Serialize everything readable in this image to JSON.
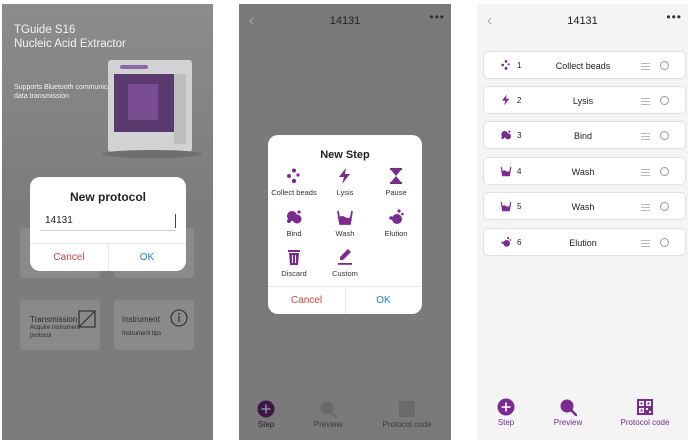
{
  "colors": {
    "accent": "#7b2b8f",
    "cancel": "#d1413e",
    "ok": "#1f7bd8"
  },
  "screen1": {
    "hero_title_line1": "TGuide S16",
    "hero_title_line2": "Nucleic Acid Extractor",
    "hero_support": "Supports Bluetooth communication, the data transmission",
    "cards": [
      {
        "label": "Transmission",
        "sub": "Acquire instrument protocol",
        "icon": "transmission-icon"
      },
      {
        "label": "Instrument",
        "sub": "Instrument tips",
        "icon": "info-icon"
      }
    ],
    "dialog": {
      "title": "New protocol",
      "input_value": "14131",
      "cancel_label": "Cancel",
      "ok_label": "OK"
    }
  },
  "screen2": {
    "header": {
      "title": "14131",
      "more": "•••"
    },
    "dialog": {
      "title": "New Step",
      "steps": [
        {
          "label": "Collect beads",
          "icon": "collect-beads-icon"
        },
        {
          "label": "Lysis",
          "icon": "lysis-icon"
        },
        {
          "label": "Pause",
          "icon": "pause-icon"
        },
        {
          "label": "Bind",
          "icon": "bind-icon"
        },
        {
          "label": "Wash",
          "icon": "wash-icon"
        },
        {
          "label": "Elution",
          "icon": "elution-icon"
        },
        {
          "label": "Discard",
          "icon": "discard-icon"
        },
        {
          "label": "Custom",
          "icon": "custom-icon"
        }
      ],
      "cancel_label": "Cancel",
      "ok_label": "OK"
    },
    "tabs": [
      {
        "label": "Step",
        "icon": "plus-circle-icon"
      },
      {
        "label": "Preview",
        "icon": "preview-icon"
      },
      {
        "label": "Protocol code",
        "icon": "qr-code-icon"
      }
    ]
  },
  "screen3": {
    "header": {
      "title": "14131",
      "more": "•••"
    },
    "steps": [
      {
        "num": "1",
        "name": "Collect beads",
        "icon": "collect-beads-icon"
      },
      {
        "num": "2",
        "name": "Lysis",
        "icon": "lysis-icon"
      },
      {
        "num": "3",
        "name": "Bind",
        "icon": "bind-icon"
      },
      {
        "num": "4",
        "name": "Wash",
        "icon": "wash-icon"
      },
      {
        "num": "5",
        "name": "Wash",
        "icon": "wash-icon"
      },
      {
        "num": "6",
        "name": "Elution",
        "icon": "elution-icon"
      }
    ],
    "tabs": [
      {
        "label": "Step",
        "icon": "plus-circle-icon"
      },
      {
        "label": "Preview",
        "icon": "preview-icon"
      },
      {
        "label": "Protocol code",
        "icon": "qr-code-icon"
      }
    ]
  }
}
